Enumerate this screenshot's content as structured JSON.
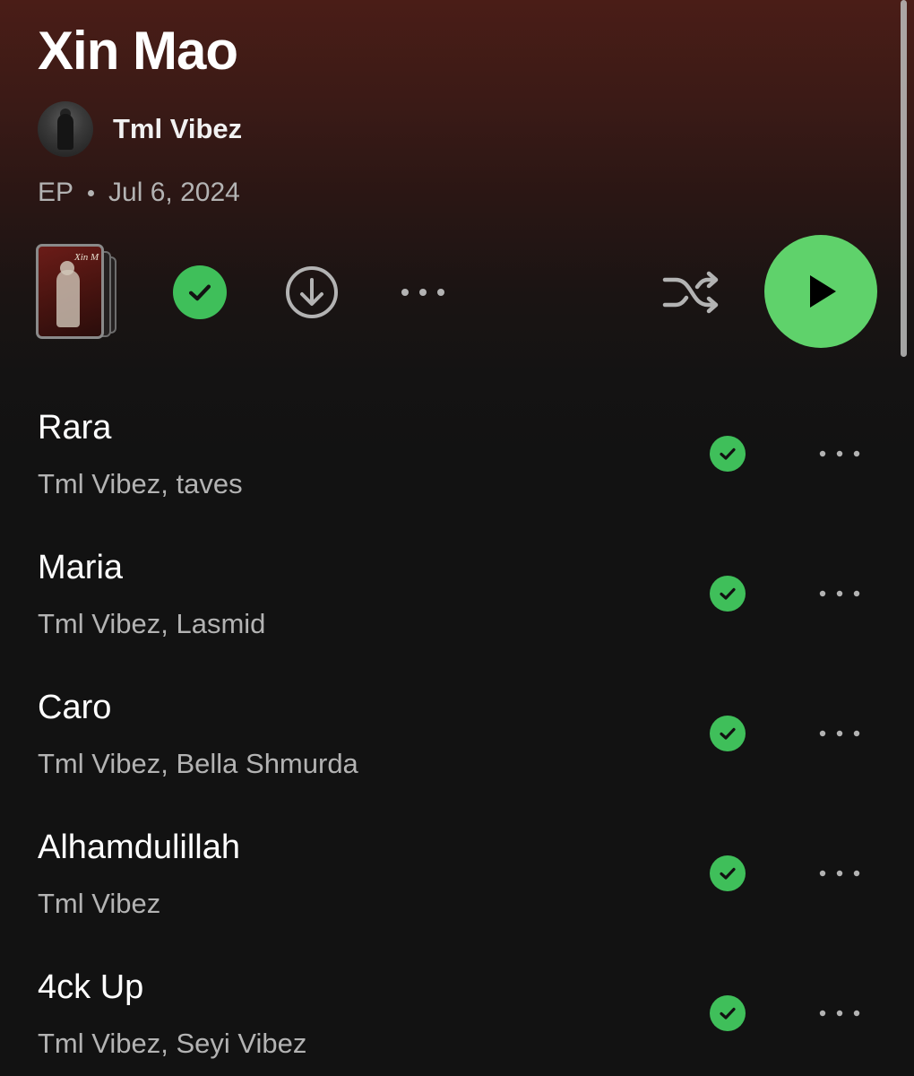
{
  "album": {
    "title": "Xin Mao",
    "artist": "Tml Vibez",
    "type": "EP",
    "release_date": "Jul 6, 2024"
  },
  "cover": {
    "text": "Xin M"
  },
  "controls": {
    "saved_icon": "check-circle-filled",
    "download_icon": "download-circle-outline",
    "more_icon": "more-horizontal",
    "shuffle_icon": "shuffle",
    "play_icon": "play-triangle"
  },
  "colors": {
    "accent_green": "#5fd26b",
    "saved_green": "#3fbf5a",
    "header_gradient_top": "#4a1d17",
    "background": "#121212",
    "secondary_text": "#b3b3b3"
  },
  "tracks": [
    {
      "title": "Rara",
      "artists": "Tml Vibez, taves"
    },
    {
      "title": "Maria",
      "artists": "Tml Vibez, Lasmid"
    },
    {
      "title": "Caro",
      "artists": "Tml Vibez, Bella Shmurda"
    },
    {
      "title": "Alhamdulillah",
      "artists": "Tml Vibez"
    },
    {
      "title": "4ck Up",
      "artists": "Tml Vibez, Seyi Vibez"
    }
  ]
}
